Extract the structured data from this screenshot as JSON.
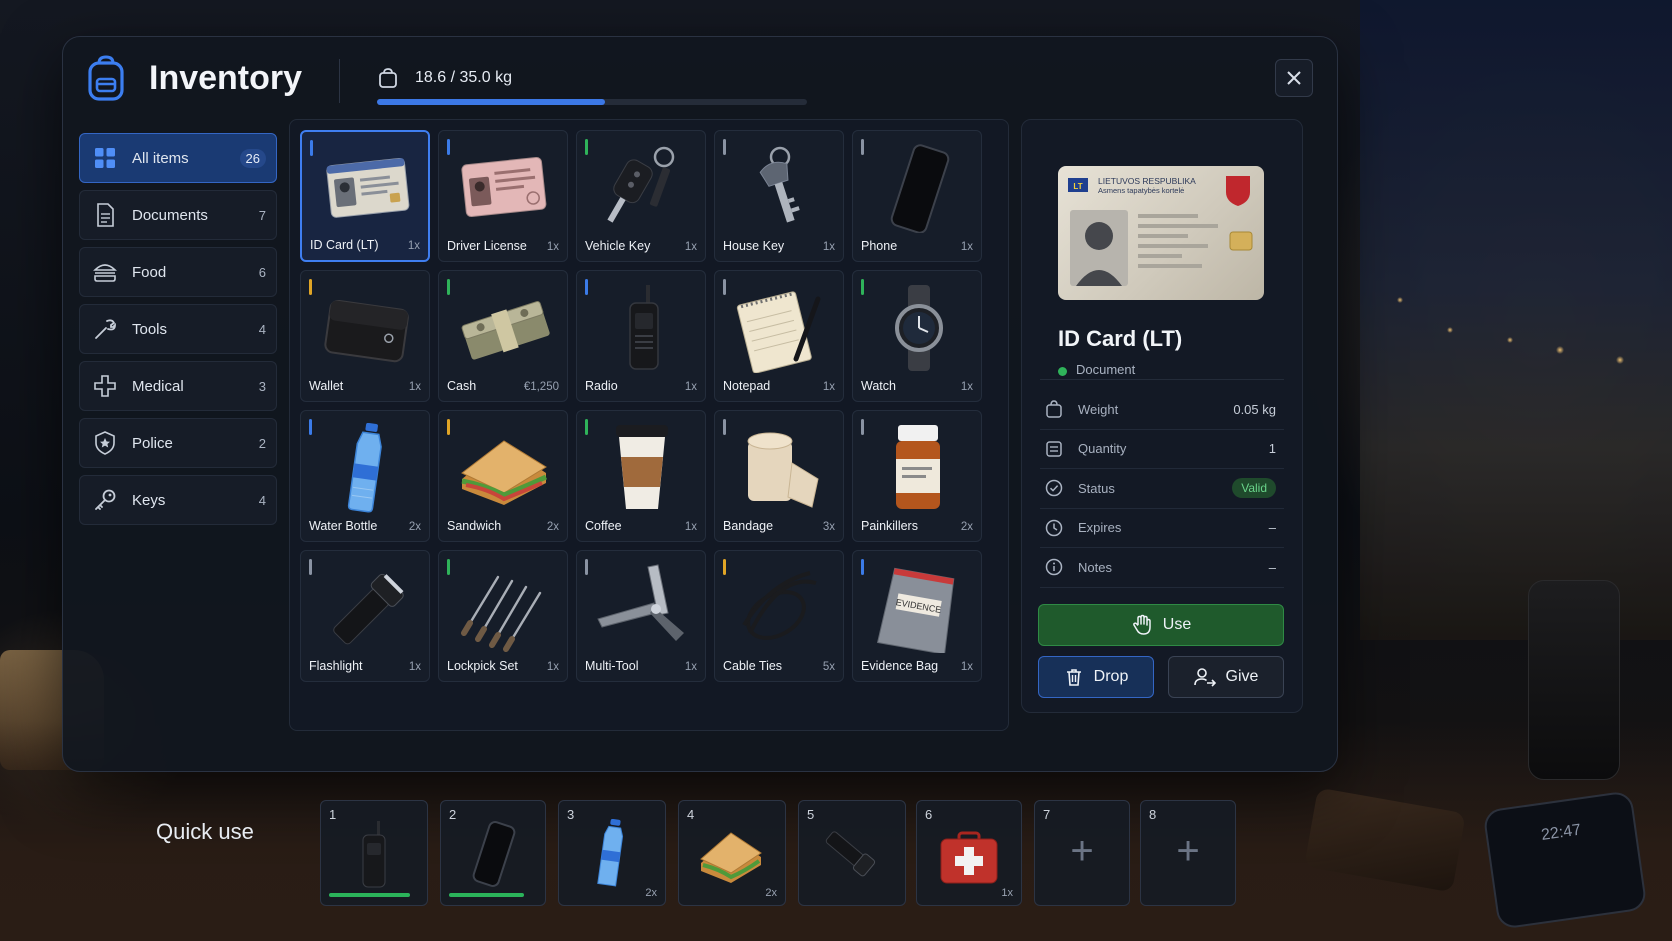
{
  "header": {
    "title": "Inventory",
    "weight_text": "18.6 / 35.0 kg",
    "weight_fraction": 0.53
  },
  "sidebar": {
    "items": [
      {
        "label": "All items",
        "count": "26",
        "icon": "grid-icon",
        "active": true
      },
      {
        "label": "Documents",
        "count": "7",
        "icon": "document-icon"
      },
      {
        "label": "Food",
        "count": "6",
        "icon": "burger-icon"
      },
      {
        "label": "Tools",
        "count": "4",
        "icon": "wrench-icon"
      },
      {
        "label": "Medical",
        "count": "3",
        "icon": "medical-cross-icon"
      },
      {
        "label": "Police",
        "count": "2",
        "icon": "police-badge-icon"
      },
      {
        "label": "Keys",
        "count": "4",
        "icon": "key-icon"
      }
    ]
  },
  "grid": {
    "items": [
      {
        "name": "ID Card (LT)",
        "qty": "1x",
        "rarity": "#3b7be8",
        "icon": "id-card-icon",
        "selected": true
      },
      {
        "name": "Driver License",
        "qty": "1x",
        "rarity": "#3b7be8",
        "icon": "driver-license-icon"
      },
      {
        "name": "Vehicle Key",
        "qty": "1x",
        "rarity": "#2fb35a",
        "icon": "vehicle-key-icon"
      },
      {
        "name": "House Key",
        "qty": "1x",
        "rarity": "#8a93a3",
        "icon": "house-key-icon"
      },
      {
        "name": "Phone",
        "qty": "1x",
        "rarity": "#8a93a3",
        "icon": "phone-icon"
      },
      {
        "name": "Wallet",
        "qty": "1x",
        "rarity": "#e0a526",
        "icon": "wallet-icon"
      },
      {
        "name": "Cash",
        "qty": "€1,250",
        "rarity": "#2fb35a",
        "icon": "cash-icon"
      },
      {
        "name": "Radio",
        "qty": "1x",
        "rarity": "#3b7be8",
        "icon": "radio-icon"
      },
      {
        "name": "Notepad",
        "qty": "1x",
        "rarity": "#8a93a3",
        "icon": "notepad-icon"
      },
      {
        "name": "Watch",
        "qty": "1x",
        "rarity": "#2fb35a",
        "icon": "watch-icon"
      },
      {
        "name": "Water Bottle",
        "qty": "2x",
        "rarity": "#3b7be8",
        "icon": "water-bottle-icon"
      },
      {
        "name": "Sandwich",
        "qty": "2x",
        "rarity": "#e0a526",
        "icon": "sandwich-icon"
      },
      {
        "name": "Coffee",
        "qty": "1x",
        "rarity": "#2fb35a",
        "icon": "coffee-icon"
      },
      {
        "name": "Bandage",
        "qty": "3x",
        "rarity": "#8a93a3",
        "icon": "bandage-icon"
      },
      {
        "name": "Painkillers",
        "qty": "2x",
        "rarity": "#8a93a3",
        "icon": "pill-bottle-icon"
      },
      {
        "name": "Flashlight",
        "qty": "1x",
        "rarity": "#8a93a3",
        "icon": "flashlight-icon"
      },
      {
        "name": "Lockpick Set",
        "qty": "1x",
        "rarity": "#2fb35a",
        "icon": "lockpick-icon"
      },
      {
        "name": "Multi-Tool",
        "qty": "1x",
        "rarity": "#8a93a3",
        "icon": "multi-tool-icon"
      },
      {
        "name": "Cable Ties",
        "qty": "5x",
        "rarity": "#e0a526",
        "icon": "cable-ties-icon"
      },
      {
        "name": "Evidence Bag",
        "qty": "1x",
        "rarity": "#3b7be8",
        "icon": "evidence-bag-icon"
      }
    ]
  },
  "details": {
    "card_header": "LIETUVOS RESPUBLIKA",
    "card_subheader": "Asmens tapatybės kortelė",
    "card_flag": "LT",
    "name": "ID Card (LT)",
    "type": "Document",
    "type_color": "#2fb35a",
    "rows": [
      {
        "label": "Weight",
        "value": "0.05 kg",
        "icon": "weight-icon"
      },
      {
        "label": "Quantity",
        "value": "1",
        "icon": "quantity-icon"
      },
      {
        "label": "Status",
        "value": "Valid",
        "icon": "check-circle-icon"
      },
      {
        "label": "Expires",
        "value": "–",
        "icon": "clock-icon"
      },
      {
        "label": "Notes",
        "value": "–",
        "icon": "info-icon"
      }
    ],
    "use_label": "Use",
    "drop_label": "Drop",
    "give_label": "Give"
  },
  "quick_use": {
    "label": "Quick use",
    "slots": [
      {
        "num": "1",
        "icon": "radio-icon",
        "qty": "",
        "durability": 0.9
      },
      {
        "num": "2",
        "icon": "phone-icon",
        "qty": "",
        "durability": 0.85
      },
      {
        "num": "3",
        "icon": "water-bottle-icon",
        "qty": "2x"
      },
      {
        "num": "4",
        "icon": "sandwich-icon",
        "qty": "2x"
      },
      {
        "num": "5",
        "icon": "flashlight-icon",
        "qty": ""
      },
      {
        "num": "6",
        "icon": "first-aid-kit-icon",
        "qty": "1x"
      },
      {
        "num": "7",
        "icon": "plus-icon",
        "qty": ""
      },
      {
        "num": "8",
        "icon": "plus-icon",
        "qty": ""
      }
    ]
  },
  "scene": {
    "phone_time": "22:47"
  }
}
